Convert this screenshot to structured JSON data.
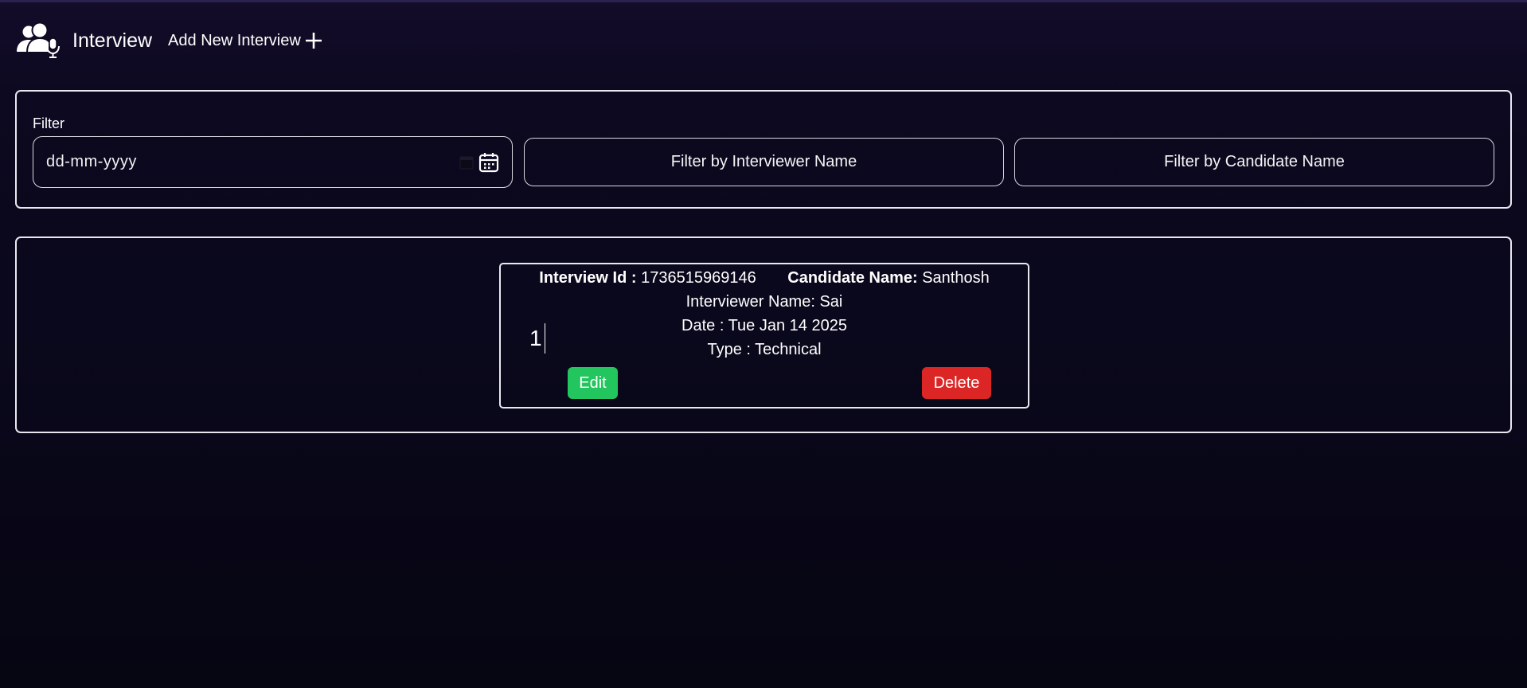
{
  "header": {
    "logo_icon": "users-microphone-icon",
    "title": "Interview",
    "add_label": "Add New Interview",
    "add_icon": "plus-icon"
  },
  "filter": {
    "label": "Filter",
    "date_value": "dd-mm-yyyy",
    "date_icon": "calendar-icon",
    "interviewer_placeholder": "Filter by Interviewer Name",
    "candidate_placeholder": "Filter by Candidate Name"
  },
  "interviews": [
    {
      "id_label": "Interview Id :",
      "id": "1736515969146",
      "candidate_label": "Candidate Name:",
      "candidate": "Santhosh",
      "interviewer_line": "Interviewer Name: Sai",
      "date_line": "Date : Tue Jan 14 2025",
      "type_line": "Type : Technical",
      "index_value": "1",
      "edit_label": "Edit",
      "delete_label": "Delete"
    }
  ],
  "colors": {
    "edit": "#22c55e",
    "delete": "#dc2626",
    "background": "#0c0920"
  }
}
